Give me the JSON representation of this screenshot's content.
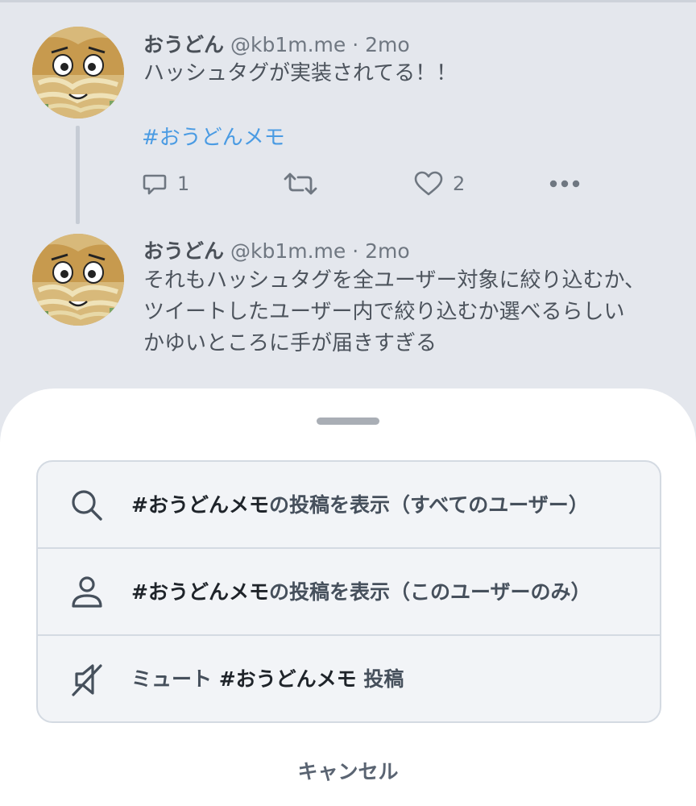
{
  "posts": [
    {
      "author": "おうどん",
      "handle": "@kb1m.me",
      "separator": "·",
      "time": "2mo",
      "lines": [
        "ハッシュタグが実装されてる！！"
      ],
      "hashtag": "#おうどんメモ",
      "actions": {
        "reply_count": "1",
        "like_count": "2"
      },
      "icons": [
        "reply-icon",
        "repost-icon",
        "like-icon",
        "more-icon"
      ]
    },
    {
      "author": "おうどん",
      "handle": "@kb1m.me",
      "separator": "·",
      "time": "2mo",
      "lines": [
        "それもハッシュタグを全ユーザー対象に絞り込むか、",
        "ツイートしたユーザー内で絞り込むか選べるらしい",
        "かゆいところに手が届きすぎる"
      ]
    }
  ],
  "sheet": {
    "items": [
      {
        "icon": "search-icon",
        "tag": "#おうどんメモ",
        "text": "の投稿を表示（すべてのユーザー）"
      },
      {
        "icon": "person-icon",
        "tag": "#おうどんメモ",
        "text": "の投稿を表示（このユーザーのみ）"
      },
      {
        "icon": "mute-icon",
        "prefix": "ミュート ",
        "tag": "#おうどんメモ",
        "suffix": " 投稿"
      }
    ],
    "cancel_label": "キャンセル"
  },
  "colors": {
    "background": "#e4e7ed",
    "hashtag": "#4a9be3",
    "sheet": "#ffffff",
    "menu_bg": "#f2f4f7"
  }
}
